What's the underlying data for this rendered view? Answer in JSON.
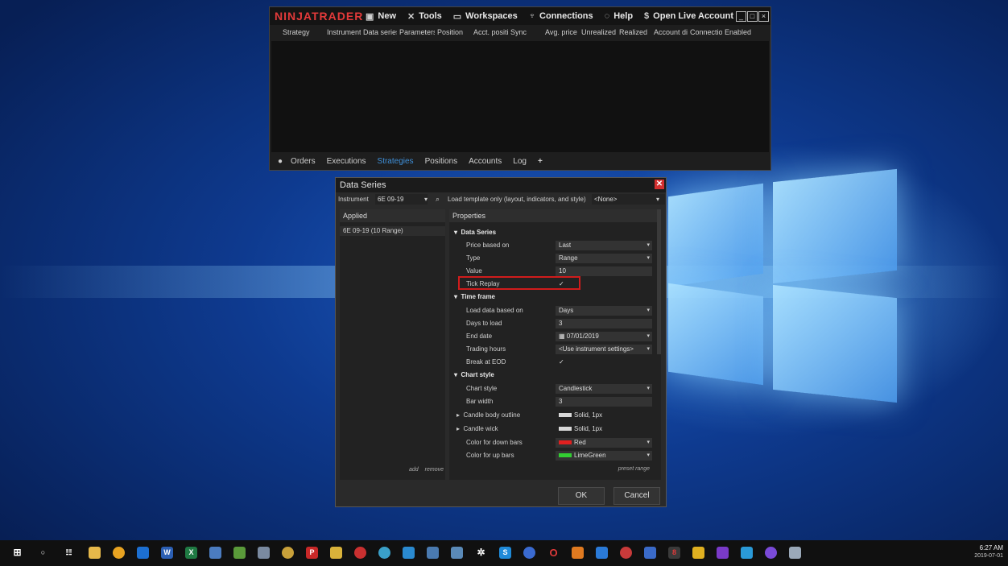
{
  "control_center": {
    "logo": "NINJATRADER",
    "menu": [
      {
        "label": "New",
        "icon": "new-icon"
      },
      {
        "label": "Tools",
        "icon": "tools-icon"
      },
      {
        "label": "Workspaces",
        "icon": "workspaces-icon"
      },
      {
        "label": "Connections",
        "icon": "connections-icon"
      },
      {
        "label": "Help",
        "icon": "help-icon"
      },
      {
        "label": "Open Live Account",
        "icon": "dollar-icon"
      }
    ],
    "columns": [
      "Strategy",
      "Instrument",
      "Data series",
      "Parameters",
      "Position",
      "Acct. position",
      "Sync",
      "Avg. price",
      "Unrealized",
      "Realized",
      "Account display",
      "Connection",
      "Enabled"
    ],
    "tabs": [
      "Orders",
      "Executions",
      "Strategies",
      "Positions",
      "Accounts",
      "Log"
    ],
    "active_tab": "Strategies",
    "add_tab": "+"
  },
  "data_series_dialog": {
    "title": "Data Series",
    "instrument_label": "Instrument",
    "instrument_value": "6E 09-19",
    "template_label": "Load template only (layout, indicators, and style)",
    "template_value": "<None>",
    "applied_header": "Applied",
    "applied_items": [
      "6E 09-19 (10 Range)"
    ],
    "add_link": "add",
    "remove_link": "remove",
    "properties_header": "Properties",
    "sections": {
      "data_series": {
        "title": "Data Series",
        "price_based_on": {
          "label": "Price based on",
          "value": "Last"
        },
        "type": {
          "label": "Type",
          "value": "Range"
        },
        "value": {
          "label": "Value",
          "value": "10"
        },
        "tick_replay": {
          "label": "Tick Replay",
          "value": "✓"
        }
      },
      "time_frame": {
        "title": "Time frame",
        "load_data_based_on": {
          "label": "Load data based on",
          "value": "Days"
        },
        "days_to_load": {
          "label": "Days to load",
          "value": "3"
        },
        "end_date": {
          "label": "End date",
          "value": "07/01/2019"
        },
        "trading_hours": {
          "label": "Trading hours",
          "value": "<Use instrument settings>"
        },
        "break_at_eod": {
          "label": "Break at EOD",
          "value": "✓"
        }
      },
      "chart_style": {
        "title": "Chart style",
        "chart_style": {
          "label": "Chart style",
          "value": "Candlestick"
        },
        "bar_width": {
          "label": "Bar width",
          "value": "3"
        },
        "candle_body_outline": {
          "label": "Candle body outline",
          "value": "Solid, 1px"
        },
        "candle_wick": {
          "label": "Candle wick",
          "value": "Solid, 1px"
        },
        "color_down": {
          "label": "Color for down bars",
          "value": "Red",
          "color": "#e02020"
        },
        "color_up": {
          "label": "Color for up bars",
          "value": "LimeGreen",
          "color": "#32cd32"
        }
      }
    },
    "preset_range_link": "preset range",
    "ok_label": "OK",
    "cancel_label": "Cancel"
  },
  "taskbar": {
    "time": "6:27 AM",
    "date": "2019-07-01"
  }
}
